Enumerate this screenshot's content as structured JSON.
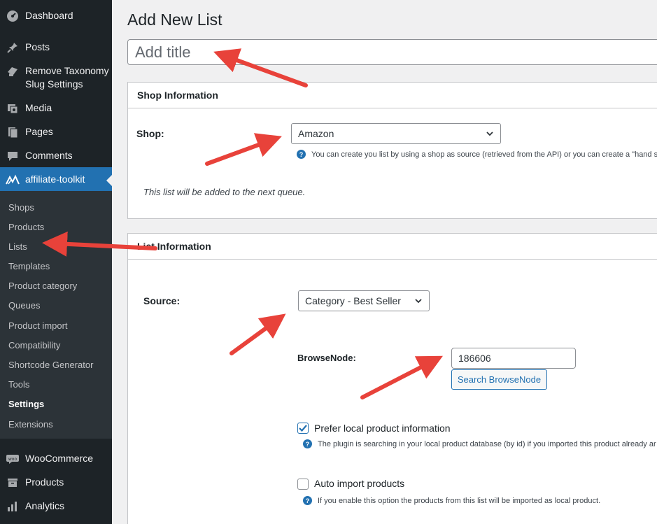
{
  "sidebar": {
    "top_items": [
      {
        "label": "Dashboard",
        "icon": "dashboard-icon"
      },
      {
        "label": "Posts",
        "icon": "pin-icon"
      },
      {
        "label": "Remove Taxonomy Slug Settings",
        "icon": "plugin-icon"
      },
      {
        "label": "Media",
        "icon": "media-icon"
      },
      {
        "label": "Pages",
        "icon": "pages-icon"
      },
      {
        "label": "Comments",
        "icon": "comments-icon"
      }
    ],
    "active_item": {
      "label": "affiliate-toolkit",
      "icon": "affiliate-toolkit-icon"
    },
    "submenu": [
      "Shops",
      "Products",
      "Lists",
      "Templates",
      "Product category",
      "Queues",
      "Product import",
      "Compatibility",
      "Shortcode Generator",
      "Tools",
      "Settings",
      "Extensions"
    ],
    "current_submenu": "Settings",
    "bottom_items": [
      {
        "label": "WooCommerce",
        "icon": "woocommerce-icon"
      },
      {
        "label": "Products",
        "icon": "products-icon"
      },
      {
        "label": "Analytics",
        "icon": "analytics-icon"
      }
    ]
  },
  "page": {
    "title": "Add New List",
    "title_placeholder": "Add title"
  },
  "shop_box": {
    "header": "Shop Information",
    "shop_label": "Shop:",
    "shop_value": "Amazon",
    "shop_help": "You can create you list by using a shop as source (retrieved from the API) or you can create a \"hand se",
    "queue_note": "This list will be added to the next queue."
  },
  "list_box": {
    "header": "List Information",
    "source_label": "Source:",
    "source_value": "Category - Best Seller",
    "browsenode_label": "BrowseNode:",
    "browsenode_value": "186606",
    "search_button": "Search BrowseNode",
    "prefer_local_label": "Prefer local product information",
    "prefer_local_checked": true,
    "prefer_local_help": "The plugin is searching in your local product database (by id) if you imported this product already ar",
    "auto_import_label": "Auto import products",
    "auto_import_checked": false,
    "auto_import_help": "If you enable this option the products from this list will be imported as local product."
  },
  "colors": {
    "sidebar_bg": "#1d2327",
    "submenu_bg": "#2c3338",
    "accent": "#2271b1",
    "annotation_arrow": "#e8423a"
  }
}
